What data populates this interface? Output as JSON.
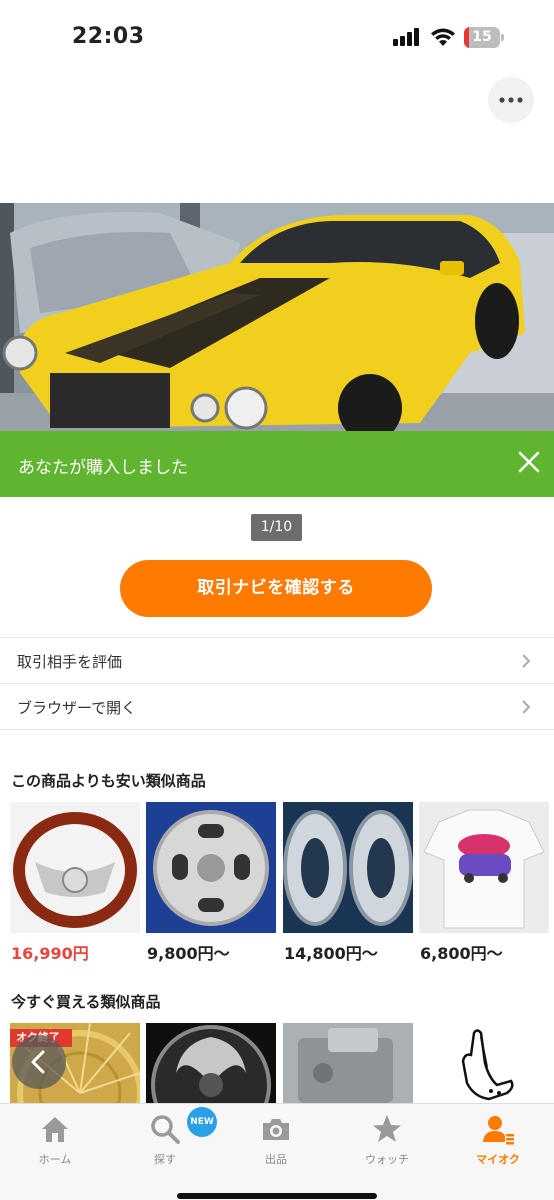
{
  "status_bar": {
    "time": "22:03",
    "battery": "15",
    "battery_level": 0.15
  },
  "hero": {
    "page_indicator": "1/10"
  },
  "banner": {
    "text": "あなたが購入しました"
  },
  "actions": {
    "trade_navi": "取引ナビを確認する"
  },
  "menu": [
    {
      "label": "取引相手を評価"
    },
    {
      "label": "ブラウザーで開く"
    }
  ],
  "cheaper_section": {
    "title": "この商品よりも安い類似商品",
    "items": [
      {
        "price": "16,990円"
      },
      {
        "price": "9,800円〜"
      },
      {
        "price": "14,800円〜"
      },
      {
        "price": "6,800円〜"
      }
    ]
  },
  "available_section": {
    "title": "今すぐ買える類似商品",
    "badge": "オク終了"
  },
  "tab_bar": {
    "tabs": [
      {
        "label": "ホーム",
        "icon": "home-icon"
      },
      {
        "label": "探す",
        "icon": "search-icon"
      },
      {
        "label": "出品",
        "icon": "camera-icon"
      },
      {
        "label": "ウォッチ",
        "icon": "star-icon"
      },
      {
        "label": "マイオク",
        "icon": "user-icon"
      }
    ],
    "new_badge": "NEW",
    "active_color": "#ff7a00"
  },
  "colors": {
    "banner": "#5fb52f",
    "accent": "#ff7a00",
    "sale_price": "#e8453c"
  }
}
